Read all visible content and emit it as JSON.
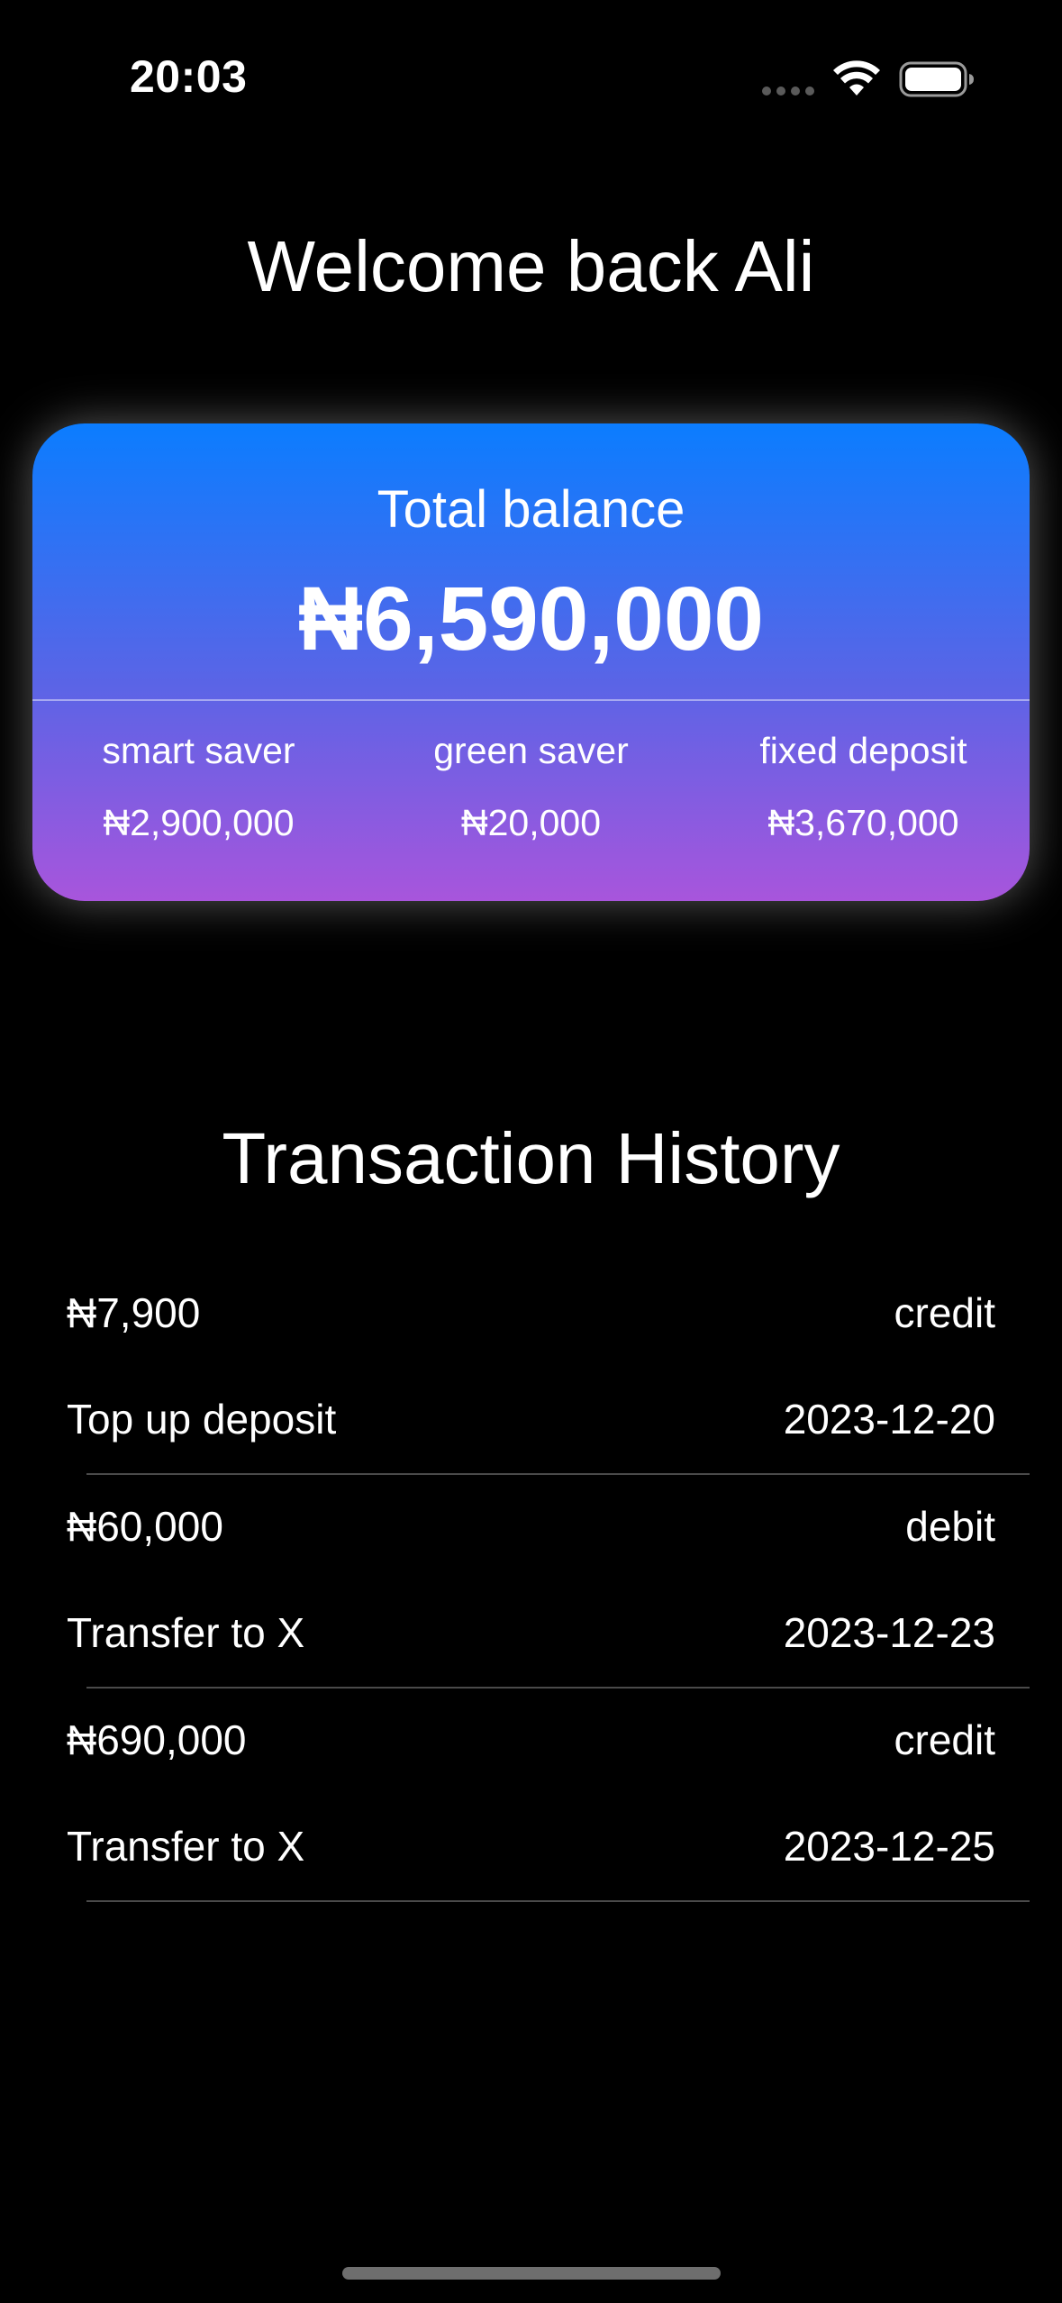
{
  "status_bar": {
    "time": "20:03"
  },
  "welcome": {
    "title": "Welcome back Ali"
  },
  "balance_card": {
    "label": "Total balance",
    "amount": "₦6,590,000",
    "accounts": [
      {
        "name": "smart saver",
        "value": "₦2,900,000"
      },
      {
        "name": "green saver",
        "value": "₦20,000"
      },
      {
        "name": "fixed deposit",
        "value": "₦3,670,000"
      }
    ],
    "gradient_top": "#0b7dff",
    "gradient_bottom": "#a855dc"
  },
  "history": {
    "title": "Transaction History",
    "transactions": [
      {
        "amount": "₦7,900",
        "type": "credit",
        "description": "Top up deposit",
        "date": "2023-12-20"
      },
      {
        "amount": "₦60,000",
        "type": "debit",
        "description": "Transfer to X",
        "date": "2023-12-23"
      },
      {
        "amount": "₦690,000",
        "type": "credit",
        "description": "Transfer to X",
        "date": "2023-12-25"
      }
    ]
  },
  "icons": [
    "wifi-icon",
    "battery-icon",
    "cellular-signal-icon"
  ]
}
